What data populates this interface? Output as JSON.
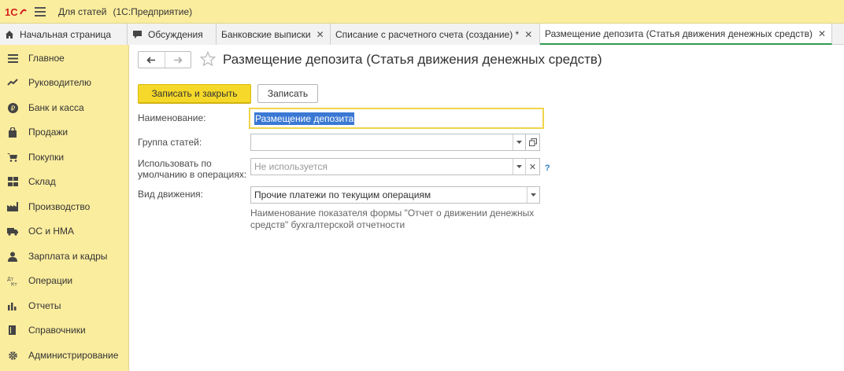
{
  "app": {
    "title": "Для статей",
    "subtitle": "(1С:Предприятие)"
  },
  "tabs": [
    {
      "label": "Начальная страница",
      "icon": "home-icon"
    },
    {
      "label": "Обсуждения",
      "icon": "chat-icon"
    },
    {
      "label": "Банковские выписки"
    },
    {
      "label": "Списание с расчетного счета (создание) *"
    },
    {
      "label": "Размещение депозита (Статья движения денежных средств)"
    }
  ],
  "sidebar": {
    "items": [
      {
        "label": "Главное",
        "icon": "menu-icon"
      },
      {
        "label": "Руководителю",
        "icon": "trend-icon"
      },
      {
        "label": "Банк и касса",
        "icon": "ruble-icon"
      },
      {
        "label": "Продажи",
        "icon": "bag-icon"
      },
      {
        "label": "Покупки",
        "icon": "cart-icon"
      },
      {
        "label": "Склад",
        "icon": "warehouse-icon"
      },
      {
        "label": "Производство",
        "icon": "factory-icon"
      },
      {
        "label": "ОС и НМА",
        "icon": "truck-icon"
      },
      {
        "label": "Зарплата и кадры",
        "icon": "person-icon"
      },
      {
        "label": "Операции",
        "icon": "operations-icon"
      },
      {
        "label": "Отчеты",
        "icon": "bar-chart-icon"
      },
      {
        "label": "Справочники",
        "icon": "book-icon"
      },
      {
        "label": "Администрирование",
        "icon": "gear-icon"
      }
    ]
  },
  "form": {
    "title": "Размещение депозита (Статья движения денежных средств)",
    "save_close_label": "Записать и закрыть",
    "save_label": "Записать",
    "fields": {
      "name": {
        "label": "Наименование:",
        "value": "Размещение депозита"
      },
      "group": {
        "label": "Группа статей:",
        "value": ""
      },
      "default_use": {
        "label_line1": "Использовать по",
        "label_line2": "умолчанию в операциях:",
        "placeholder": "Не используется"
      },
      "movement_type": {
        "label": "Вид движения:",
        "value": "Прочие платежи по текущим операциям"
      }
    },
    "help_mark": "?",
    "hint": "Наименование показателя формы \"Отчет о движении денежных средств\" бухгалтерской отчетности"
  },
  "colors": {
    "titlebar": "#fbed9e",
    "primary_button": "#f5d829",
    "active_tab_underline": "#2d9b4f",
    "selection": "#3a78d4"
  }
}
